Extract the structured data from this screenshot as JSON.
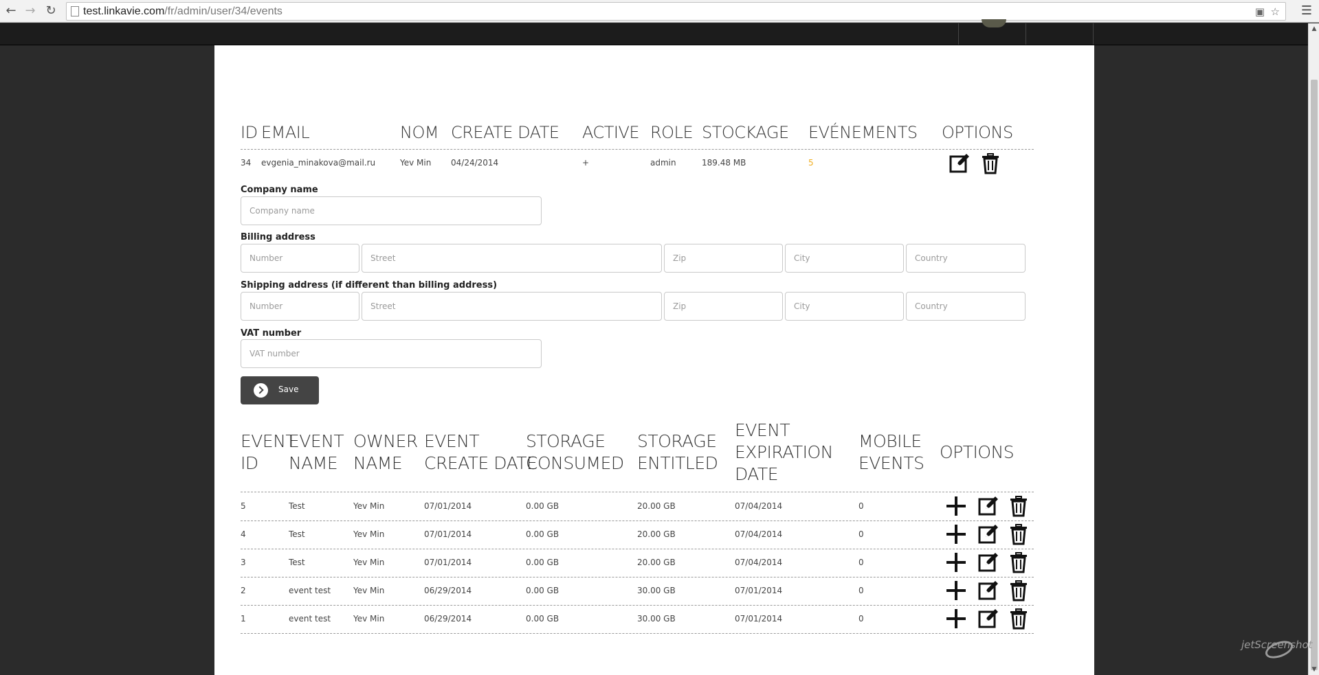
{
  "browser": {
    "url_host": "test.linkavie.com",
    "url_path": "/fr/admin/user/34/events"
  },
  "user_table": {
    "headers": [
      "ID",
      "EMAIL",
      "NOM",
      "CREATE DATE",
      "ACTIVE",
      "ROLE",
      "STOCKAGE",
      "EVÉNEMENTS",
      "OPTIONS"
    ],
    "row": {
      "id": "34",
      "email": "evgenia_minakova@mail.ru",
      "nom": "Yev Min",
      "create_date": "04/24/2014",
      "active": "+",
      "role": "admin",
      "stockage": "189.48 MB",
      "evenements": "5"
    }
  },
  "form": {
    "company_label": "Company name",
    "company_placeholder": "Company name",
    "billing_label": "Billing address",
    "shipping_label": "Shipping address (if different than billing address)",
    "number_placeholder": "Number",
    "street_placeholder": "Street",
    "zip_placeholder": "Zip",
    "city_placeholder": "City",
    "country_placeholder": "Country",
    "vat_label": "VAT number",
    "vat_placeholder": "VAT number",
    "save_label": "Save"
  },
  "events_table": {
    "headers": {
      "event_id": [
        "EVENT",
        "ID"
      ],
      "event_name": [
        "EVENT",
        "NAME"
      ],
      "owner_name": [
        "OWNER",
        "NAME"
      ],
      "event_create_date": [
        "EVENT",
        "CREATE DATE"
      ],
      "storage_consumed": [
        "STORAGE",
        "CONSUMED"
      ],
      "storage_entitled": [
        "STORAGE",
        "ENTITLED"
      ],
      "event_expiration_date": [
        "EVENT",
        "EXPIRATION",
        "DATE"
      ],
      "mobile_events": [
        "MOBILE",
        "EVENTS"
      ],
      "options": "OPTIONS"
    },
    "rows": [
      {
        "id": "5",
        "name": "Test",
        "owner": "Yev Min",
        "created": "07/01/2014",
        "consumed": "0.00 GB",
        "entitled": "20.00 GB",
        "expires": "07/04/2014",
        "mobile": "0"
      },
      {
        "id": "4",
        "name": "Test",
        "owner": "Yev Min",
        "created": "07/01/2014",
        "consumed": "0.00 GB",
        "entitled": "20.00 GB",
        "expires": "07/04/2014",
        "mobile": "0"
      },
      {
        "id": "3",
        "name": "Test",
        "owner": "Yev Min",
        "created": "07/01/2014",
        "consumed": "0.00 GB",
        "entitled": "20.00 GB",
        "expires": "07/04/2014",
        "mobile": "0"
      },
      {
        "id": "2",
        "name": "event test",
        "owner": "Yev Min",
        "created": "06/29/2014",
        "consumed": "0.00 GB",
        "entitled": "30.00 GB",
        "expires": "07/01/2014",
        "mobile": "0"
      },
      {
        "id": "1",
        "name": "event test",
        "owner": "Yev Min",
        "created": "06/29/2014",
        "consumed": "0.00 GB",
        "entitled": "30.00 GB",
        "expires": "07/01/2014",
        "mobile": "0"
      }
    ]
  },
  "icons": {
    "add": "plus-icon",
    "edit": "edit-icon",
    "delete": "trash-icon"
  },
  "colors": {
    "event_count": "#f0ad1f",
    "save_button": "#444444",
    "page_background": "#2b2b2b"
  },
  "watermark": "jetScreenshot"
}
